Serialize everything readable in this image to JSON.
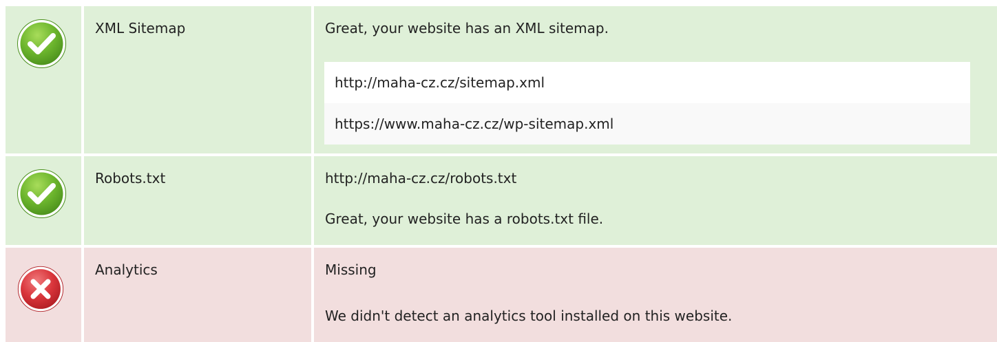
{
  "checks": [
    {
      "label": "XML Sitemap",
      "status": "pass",
      "message": "Great, your website has an XML sitemap.",
      "urls": [
        "http://maha-cz.cz/sitemap.xml",
        "https://www.maha-cz.cz/wp-sitemap.xml"
      ]
    },
    {
      "label": "Robots.txt",
      "status": "pass",
      "url": "http://maha-cz.cz/robots.txt",
      "message": "Great, your website has a robots.txt file."
    },
    {
      "label": "Analytics",
      "status": "fail",
      "value": "Missing",
      "message": "We didn't detect an analytics tool installed on this website."
    }
  ],
  "icons": {
    "pass": "check-circle-icon",
    "fail": "x-circle-icon"
  },
  "colors": {
    "pass_bg": "#dff0d8",
    "fail_bg": "#f2dede",
    "pass_icon": "#6cb52d",
    "fail_icon": "#d9353b"
  }
}
